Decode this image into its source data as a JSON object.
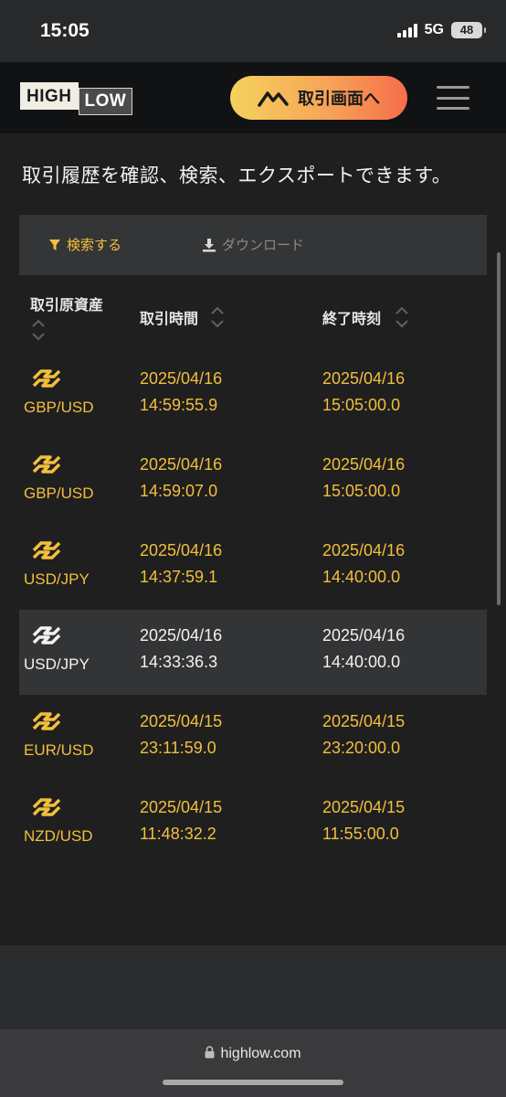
{
  "status_bar": {
    "time": "15:05",
    "network": "5G",
    "battery": "48"
  },
  "header": {
    "logo_high": "HIGH",
    "logo_low": "LOW",
    "trade_button": "取引画面へ"
  },
  "intro": "取引履歴を確認、検索、エクスポートできます。",
  "toolbar": {
    "search": "検索する",
    "download": "ダウンロード"
  },
  "table": {
    "headers": {
      "asset": "取引原資産",
      "open_time": "取引時間",
      "end_time": "終了時刻"
    },
    "rows": [
      {
        "pair": "GBP/USD",
        "open_date": "2025/04/16",
        "open_time": "14:59:55.9",
        "end_date": "2025/04/16",
        "end_time": "15:05:00.0",
        "highlight": "gold"
      },
      {
        "pair": "GBP/USD",
        "open_date": "2025/04/16",
        "open_time": "14:59:07.0",
        "end_date": "2025/04/16",
        "end_time": "15:05:00.0",
        "highlight": "gold"
      },
      {
        "pair": "USD/JPY",
        "open_date": "2025/04/16",
        "open_time": "14:37:59.1",
        "end_date": "2025/04/16",
        "end_time": "14:40:00.0",
        "highlight": "gold"
      },
      {
        "pair": "USD/JPY",
        "open_date": "2025/04/16",
        "open_time": "14:33:36.3",
        "end_date": "2025/04/16",
        "end_time": "14:40:00.0",
        "highlight": "white"
      },
      {
        "pair": "EUR/USD",
        "open_date": "2025/04/15",
        "open_time": "23:11:59.0",
        "end_date": "2025/04/15",
        "end_time": "23:20:00.0",
        "highlight": "gold"
      },
      {
        "pair": "NZD/USD",
        "open_date": "2025/04/15",
        "open_time": "11:48:32.2",
        "end_date": "2025/04/15",
        "end_time": "11:55:00.0",
        "highlight": "gold"
      }
    ]
  },
  "browser": {
    "url": "highlow.com"
  },
  "colors": {
    "gold": "#f3bf3b",
    "white": "#f2f2f2",
    "background": "#1f1f20"
  }
}
